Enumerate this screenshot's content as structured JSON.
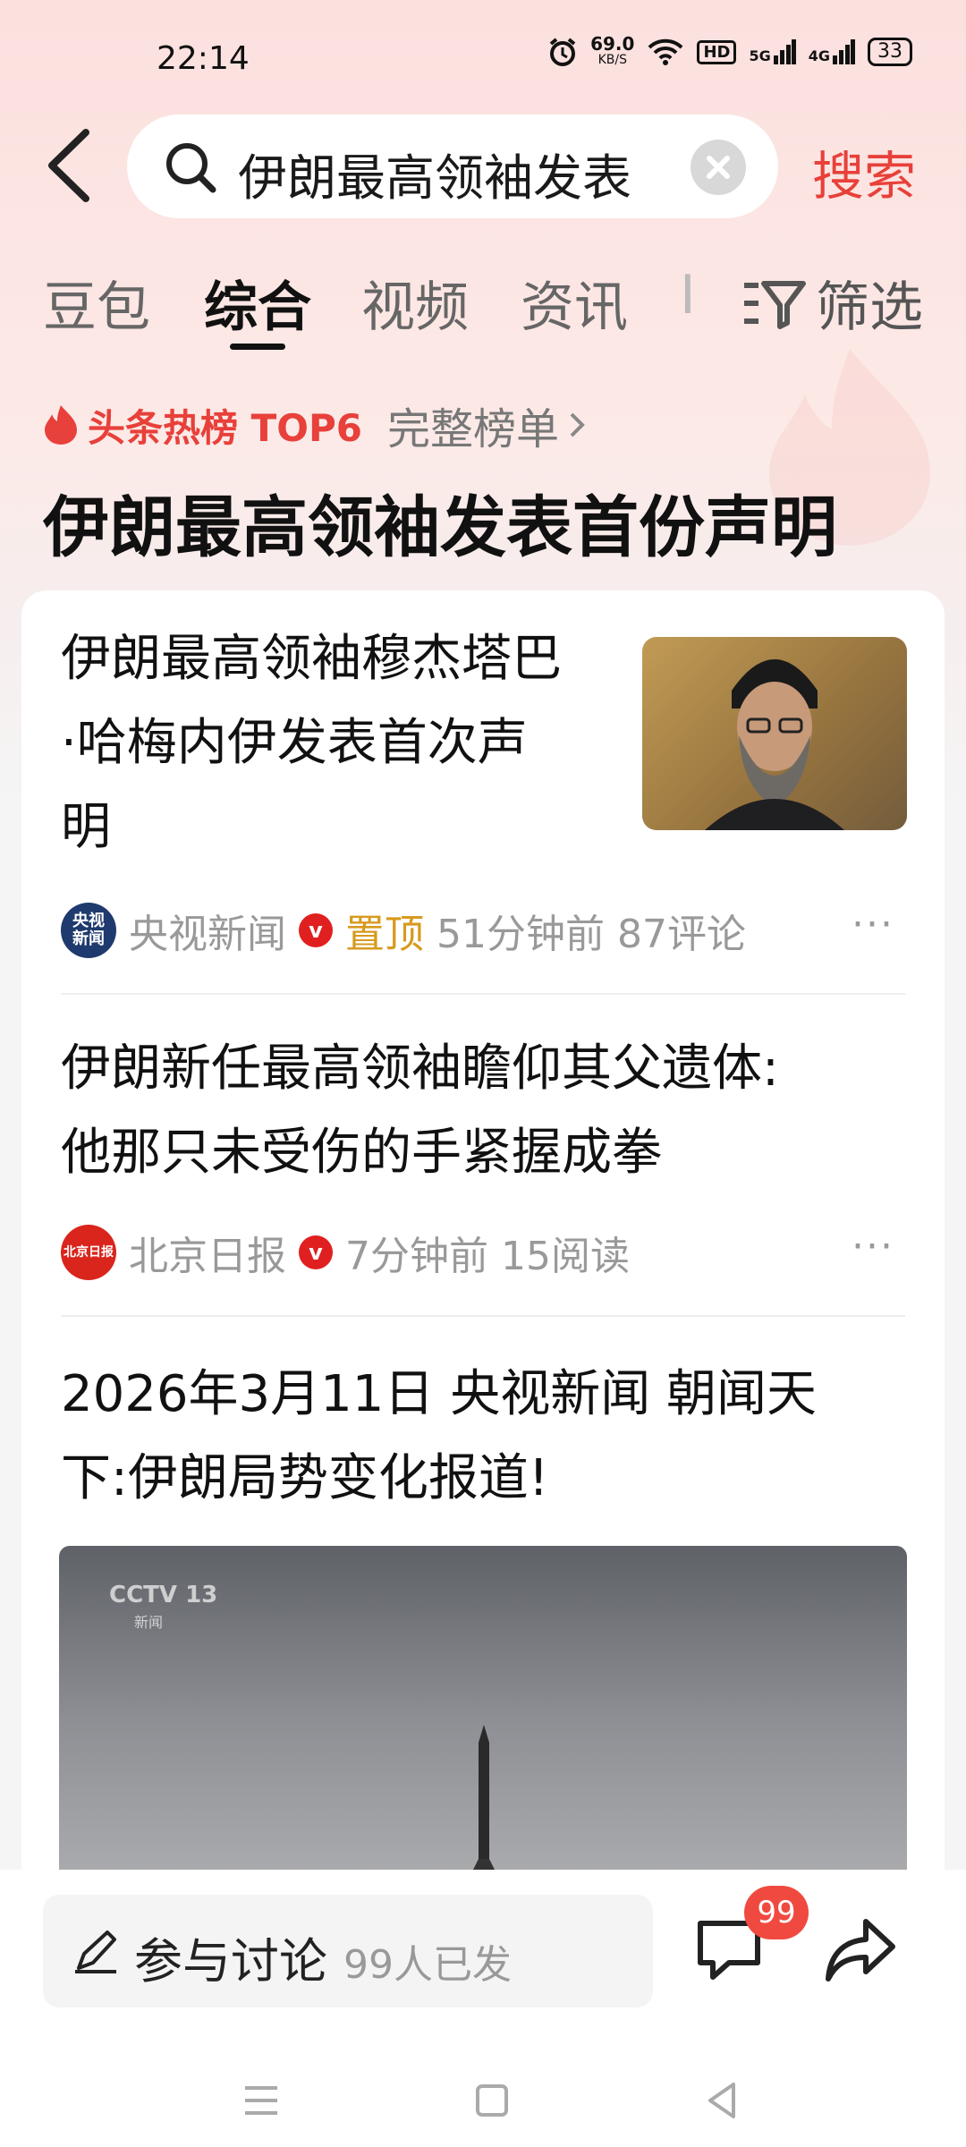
{
  "status_bar": {
    "time": "22:14",
    "net_speed": "69.0",
    "net_unit": "KB/S",
    "hd_label": "HD",
    "signal1": "5G",
    "signal2": "4G",
    "battery": "33"
  },
  "search": {
    "query": "伊朗最高领袖发表",
    "button_label": "搜索"
  },
  "tabs": [
    {
      "label": "豆包"
    },
    {
      "label": "综合",
      "active": true
    },
    {
      "label": "视频"
    },
    {
      "label": "资讯"
    },
    {
      "label": "I"
    }
  ],
  "filter_label": "筛选",
  "hot": {
    "tag": "头条热榜 TOP6",
    "more": "完整榜单",
    "headline": "伊朗最高领袖发表首份声明"
  },
  "news": [
    {
      "title_lines": [
        "伊朗最高领袖穆杰塔巴",
        "·哈梅内伊发表首次声",
        "明"
      ],
      "source": "央视新闻",
      "source_logo": "央视\n新闻",
      "pinned": "置顶",
      "time": "51分钟前",
      "stat": "87评论"
    },
    {
      "title_lines": [
        "伊朗新任最高领袖瞻仰其父遗体:",
        "他那只未受伤的手紧握成拳"
      ],
      "source": "北京日报",
      "time": "7分钟前",
      "stat": "15阅读"
    },
    {
      "title_lines": [
        "2026年3月11日 央视新闻 朝闻天",
        "下:伊朗局势变化报道!"
      ],
      "video_watermark": "CCTV 13",
      "video_watermark_sub": "新闻"
    }
  ],
  "bottom": {
    "discuss_label": "参与讨论",
    "discuss_count": "99人已发",
    "comment_badge": "99"
  },
  "colors": {
    "accent": "#e8403a",
    "pin": "#d79a1e",
    "meta": "#999999"
  }
}
